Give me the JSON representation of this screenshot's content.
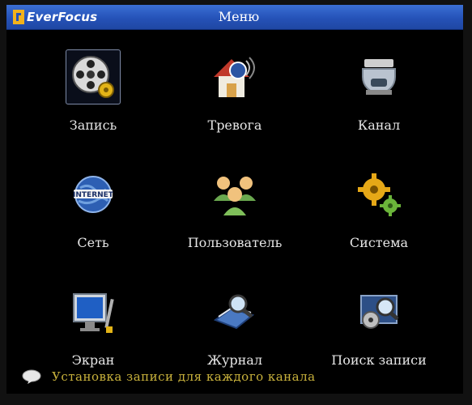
{
  "header": {
    "brand": "EverFocus",
    "title": "Меню"
  },
  "menu": {
    "items": [
      {
        "label": "Запись",
        "icon": "film-reel-icon",
        "selected": true
      },
      {
        "label": "Тревога",
        "icon": "alarm-house-icon"
      },
      {
        "label": "Канал",
        "icon": "dome-camera-icon"
      },
      {
        "label": "Сеть",
        "icon": "internet-globe-icon"
      },
      {
        "label": "Пользователь",
        "icon": "users-icon"
      },
      {
        "label": "Система",
        "icon": "gears-icon"
      },
      {
        "label": "Экран",
        "icon": "monitor-icon"
      },
      {
        "label": "Журнал",
        "icon": "log-search-icon"
      },
      {
        "label": "Поиск записи",
        "icon": "record-search-icon"
      }
    ]
  },
  "status": {
    "text": "Установка записи для каждого канала",
    "icon": "speech-bubble-icon"
  },
  "colors": {
    "titlebar": "#2552b8",
    "status_text": "#c9b23c",
    "label_text": "#e6e6e6"
  }
}
